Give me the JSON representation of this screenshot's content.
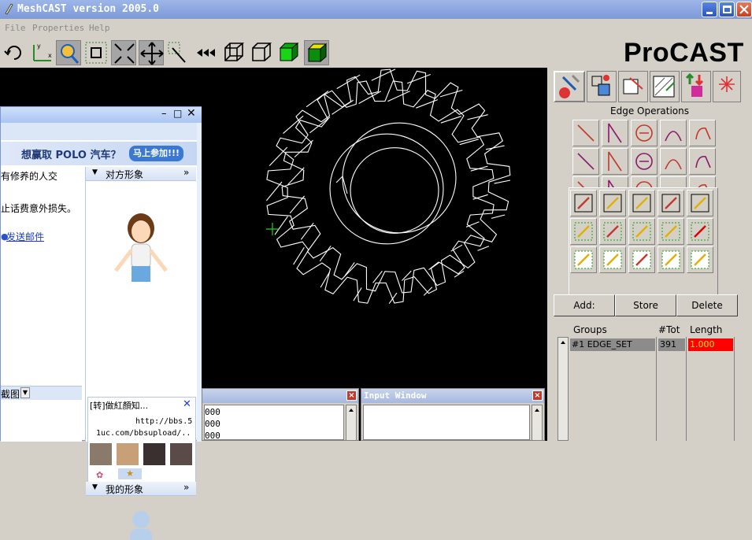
{
  "window": {
    "title": "MeshCAST version 2005.0"
  },
  "menu": {
    "items": [
      "File",
      "Properties",
      "Help"
    ]
  },
  "brand": {
    "text": "ProCAST"
  },
  "right_panel": {
    "section_label": "Edge Operations",
    "buttons": {
      "add": "Add:",
      "store": "Store",
      "delete": "Delete"
    },
    "groups": {
      "headers": {
        "groups": "Groups",
        "tot": "#Tot",
        "length": "Length"
      },
      "rows": [
        {
          "id": "#1",
          "name": "EDGE_SET",
          "tot": "391",
          "length": "1.000"
        }
      ]
    }
  },
  "chat": {
    "banner_text": "想赢取 POLO 汽车？",
    "banner_button": "马上参加!!!",
    "left_text_1": "有修养的人交",
    "left_text_2": "止话费意外损失。",
    "send_mail": "发送邮件",
    "screenshot_label": "截图",
    "section_other": "对方形象",
    "section_mine": "我的形象",
    "forward_item": "[转]做紅顏知...",
    "link_line_1": "http://bbs.5",
    "link_line_2": "1uc.com/bbsupload/.."
  },
  "bottom": {
    "left_values": [
      "000",
      "000",
      "000"
    ],
    "input_window_title": "Input Window"
  },
  "colors": {
    "length_bg": "#ff0000",
    "viewport_bg": "#000000",
    "group_sel": "#8c8c8c"
  }
}
